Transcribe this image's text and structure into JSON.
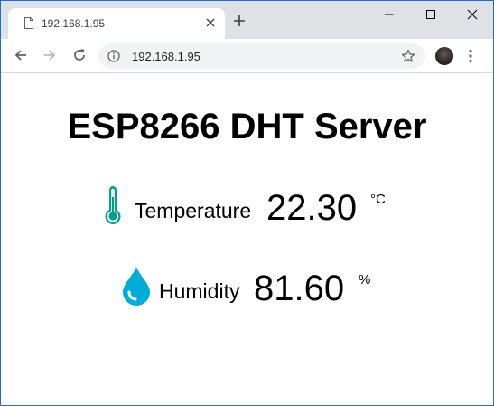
{
  "browser": {
    "tab": {
      "title": "192.168.1.95",
      "favicon": "page-icon"
    },
    "toolbar": {
      "url": "192.168.1.95",
      "icons": [
        "back-arrow-icon",
        "forward-arrow-icon",
        "reload-icon",
        "info-icon",
        "star-icon",
        "menu-icon"
      ]
    }
  },
  "page": {
    "title": "ESP8266 DHT Server",
    "readings": [
      {
        "icon": "thermometer-icon",
        "label": "Temperature",
        "value": "22.30",
        "unit": "°C"
      },
      {
        "icon": "water-drop-icon",
        "label": "Humidity",
        "value": "81.60",
        "unit": "%"
      }
    ]
  },
  "colors": {
    "thermometer": "#059e8a",
    "water_drop": "#00add6",
    "tabstrip": "#dee1e6",
    "window_border": "#1f6fc5"
  }
}
